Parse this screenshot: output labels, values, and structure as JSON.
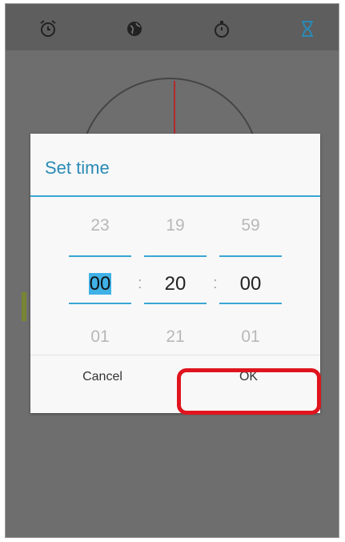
{
  "tabs": [
    {
      "icon": "alarm-clock-icon"
    },
    {
      "icon": "world-clock-icon"
    },
    {
      "icon": "stopwatch-icon"
    },
    {
      "icon": "timer-icon"
    }
  ],
  "dialog": {
    "title": "Set time",
    "hours": {
      "prev": "23",
      "current": "00",
      "next": "01"
    },
    "minutes": {
      "prev": "19",
      "current": "20",
      "next": "21"
    },
    "seconds": {
      "prev": "59",
      "current": "00",
      "next": "01"
    },
    "separator": ":",
    "cancel_label": "Cancel",
    "ok_label": "OK"
  },
  "colors": {
    "accent": "#39a6d4",
    "highlight": "#e0141e"
  }
}
